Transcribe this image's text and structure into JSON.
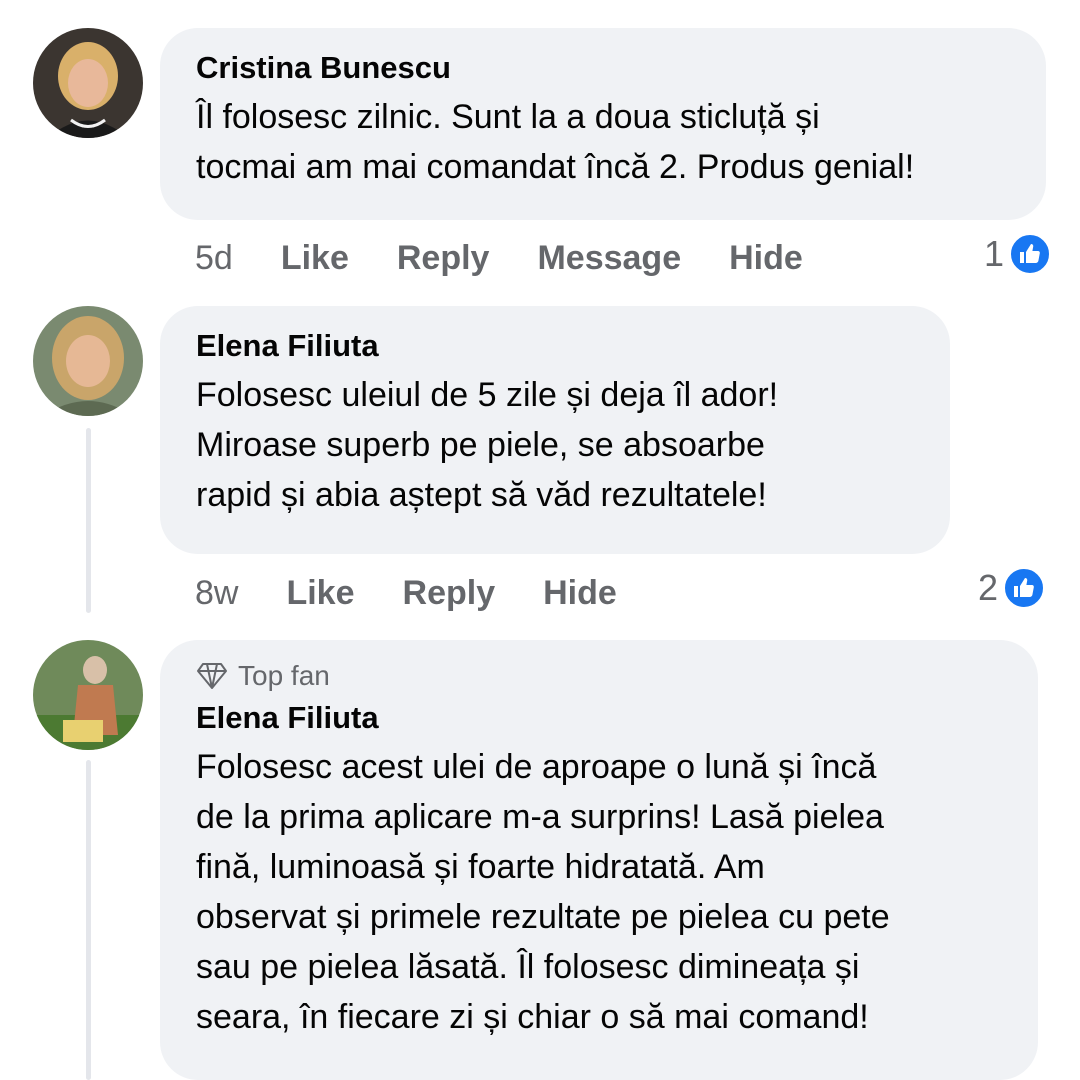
{
  "comments": [
    {
      "author": "Cristina Bunescu",
      "lines": [
        "Îl folosesc zilnic. Sunt la a doua sticluță și",
        "tocmai am mai comandat încă 2. Produs genial!"
      ],
      "time": "5d",
      "actions": [
        "Like",
        "Reply",
        "Message",
        "Hide"
      ],
      "reaction_count": "1"
    },
    {
      "author": "Elena Filiuta",
      "lines": [
        "Folosesc uleiul de 5 zile și deja îl ador!",
        "Miroase superb pe piele, se absoarbe",
        "rapid și abia aștept să văd rezultatele!"
      ],
      "time": "8w",
      "actions": [
        "Like",
        "Reply",
        "Hide"
      ],
      "reaction_count": "2"
    },
    {
      "badge": "Top fan",
      "author": "Elena Filiuta",
      "lines": [
        "Folosesc acest ulei de aproape o lună și încă",
        "de la prima aplicare m-a surprins! Lasă pielea",
        "fină, luminoasă și foarte hidratată. Am",
        "observat și primele rezultate pe pielea cu pete",
        "sau pe pielea lăsată. Îl folosesc dimineața și",
        "seara, în fiecare zi și chiar o să mai comand!"
      ]
    }
  ],
  "colors": {
    "bubble": "#f0f2f5",
    "meta_text": "#65676b",
    "like_blue": "#1877f2"
  },
  "icons": {
    "like": "thumbs-up-icon",
    "badge": "diamond-icon"
  }
}
